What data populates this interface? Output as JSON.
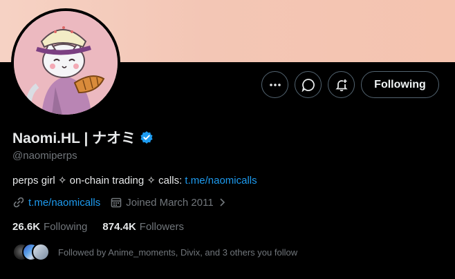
{
  "profile": {
    "display_name": "Naomi.HL | ナオミ",
    "handle": "@naomiperps",
    "bio_text": "perps girl ✧ on-chain trading ✧ calls: ",
    "bio_link": "t.me/naomicalls",
    "website": "t.me/naomicalls",
    "joined": "Joined March 2011",
    "following_count": "26.6K",
    "following_label": "Following",
    "followers_count": "874.4K",
    "followers_label": "Followers",
    "followed_by": "Followed by Anime_moments, Divix, and 3 others you follow"
  },
  "actions": {
    "more_icon": "more-dots-icon",
    "message_icon": "message-icon",
    "notify_icon": "bell-plus-icon",
    "following_button": "Following"
  },
  "colors": {
    "background": "#000000",
    "text_primary": "#e7e9ea",
    "text_secondary": "#71767b",
    "link": "#1d9bf0",
    "verified": "#1d9bf0",
    "banner": "#f3c6b5"
  }
}
